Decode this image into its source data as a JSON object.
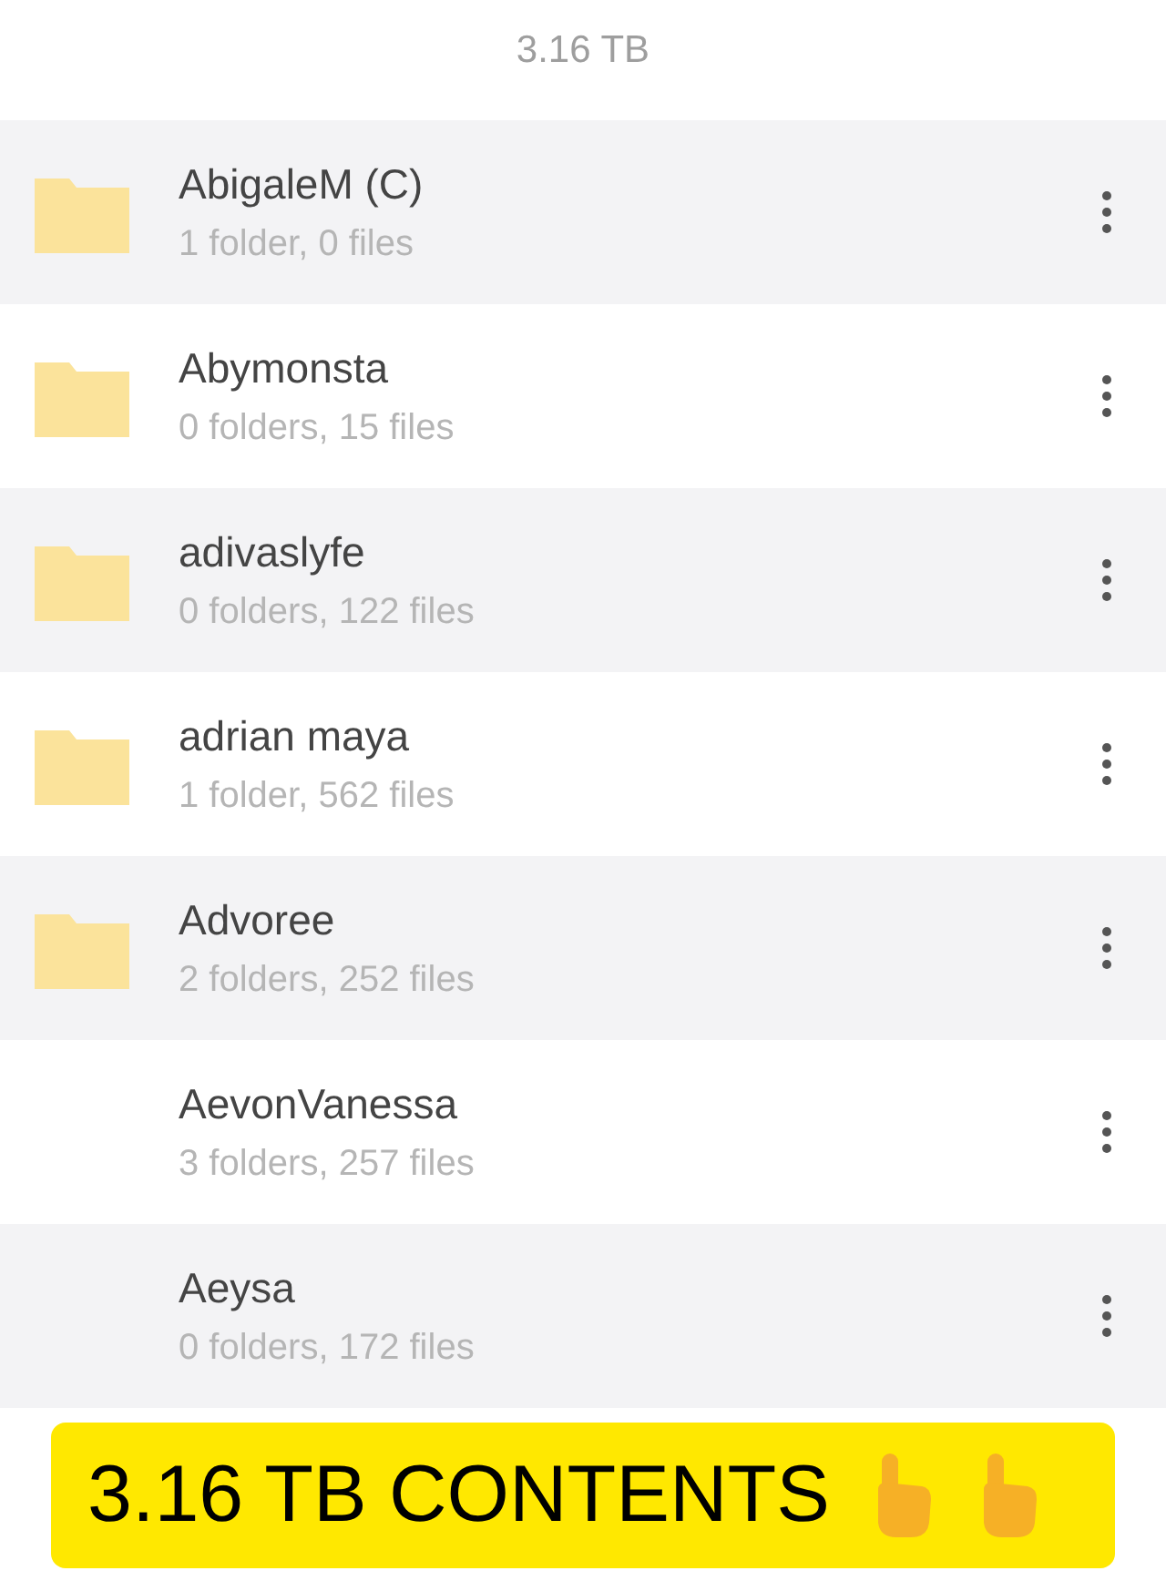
{
  "header": {
    "size": "3.16 TB"
  },
  "items": [
    {
      "name": "AbigaleM (C)",
      "details": "1 folder, 0 files",
      "icon_shown": true
    },
    {
      "name": "Abymonsta",
      "details": "0 folders, 15 files",
      "icon_shown": true
    },
    {
      "name": "adivaslyfe",
      "details": "0 folders, 122 files",
      "icon_shown": true
    },
    {
      "name": "adrian maya",
      "details": "1 folder, 562 files",
      "icon_shown": true
    },
    {
      "name": "Advoree",
      "details": "2 folders, 252 files",
      "icon_shown": true
    },
    {
      "name": "AevonVanessa",
      "details": "3 folders, 257 files",
      "icon_shown": false
    },
    {
      "name": "Aeysa",
      "details": "0 folders, 172 files",
      "icon_shown": false
    }
  ],
  "banner": {
    "text": "3.16 TB CONTENTS"
  }
}
